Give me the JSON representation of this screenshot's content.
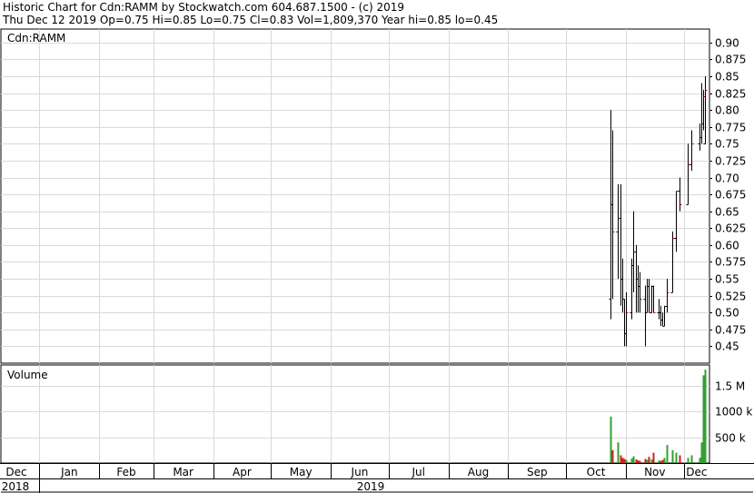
{
  "header": {
    "line1": "Historic Chart for Cdn:RAMM by Stockwatch.com 604.687.1500 - (c) 2019",
    "line2": "Thu Dec 12 2019  Op=0.75  Hi=0.85  Lo=0.75  Cl=0.83  Vol=1,809,370  Year hi=0.85  lo=0.45"
  },
  "chart_data": {
    "type": "ohlc",
    "symbol_label": "Cdn:RAMM",
    "volume_label": "Volume",
    "price_axis": {
      "min": 0.425,
      "max": 0.92,
      "ticks": [
        0.45,
        0.475,
        0.5,
        0.525,
        0.55,
        0.575,
        0.6,
        0.625,
        0.65,
        0.675,
        0.7,
        0.725,
        0.75,
        0.775,
        0.8,
        0.825,
        0.85,
        0.875,
        0.9
      ],
      "tick_labels": [
        "0.45",
        "0.475",
        "0.50",
        "0.525",
        "0.55",
        "0.575",
        "0.60",
        "0.625",
        "0.65",
        "0.675",
        "0.70",
        "0.725",
        "0.75",
        "0.775",
        "0.80",
        "0.825",
        "0.85",
        "0.875",
        "0.90"
      ]
    },
    "volume_axis": {
      "min": 0,
      "max": 1900000,
      "ticks": [
        500000,
        1000000,
        1500000
      ],
      "tick_labels": [
        "500 k",
        "1000 k",
        "1.5 M"
      ]
    },
    "date_range": [
      "2018-12-12",
      "2019-12-12"
    ],
    "months": [
      {
        "label": "Dec",
        "date": "2018-12-01"
      },
      {
        "label": "Jan",
        "date": "2019-01-01"
      },
      {
        "label": "Feb",
        "date": "2019-02-01"
      },
      {
        "label": "Mar",
        "date": "2019-03-01"
      },
      {
        "label": "Apr",
        "date": "2019-04-01"
      },
      {
        "label": "May",
        "date": "2019-05-01"
      },
      {
        "label": "Jun",
        "date": "2019-06-01"
      },
      {
        "label": "Jul",
        "date": "2019-07-01"
      },
      {
        "label": "Aug",
        "date": "2019-08-01"
      },
      {
        "label": "Sep",
        "date": "2019-09-01"
      },
      {
        "label": "Oct",
        "date": "2019-10-01"
      },
      {
        "label": "Nov",
        "date": "2019-11-01"
      },
      {
        "label": "Dec",
        "date": "2019-12-01"
      }
    ],
    "years": [
      {
        "label": "2018"
      },
      {
        "label": "2019"
      }
    ],
    "colors": {
      "background": "#ffffff",
      "grid": "#d9d9d9",
      "bars": "#000000",
      "close_tick": "#cc0000",
      "volume": "#33a033",
      "volume_down": "#cc2222"
    },
    "bars": [
      {
        "date": "2019-10-24",
        "open": 0.52,
        "high": 0.8,
        "low": 0.49,
        "close": 0.66,
        "volume": 900000
      },
      {
        "date": "2019-10-25",
        "open": 0.66,
        "high": 0.77,
        "low": 0.52,
        "close": 0.62,
        "volume": 250000
      },
      {
        "date": "2019-10-28",
        "open": 0.62,
        "high": 0.69,
        "low": 0.55,
        "close": 0.64,
        "volume": 400000
      },
      {
        "date": "2019-10-29",
        "open": 0.64,
        "high": 0.69,
        "low": 0.51,
        "close": 0.55,
        "volume": 150000
      },
      {
        "date": "2019-10-30",
        "open": 0.55,
        "high": 0.58,
        "low": 0.5,
        "close": 0.52,
        "volume": 100000
      },
      {
        "date": "2019-10-31",
        "open": 0.52,
        "high": 0.52,
        "low": 0.45,
        "close": 0.47,
        "volume": 80000
      },
      {
        "date": "2019-11-01",
        "open": 0.47,
        "high": 0.53,
        "low": 0.45,
        "close": 0.5,
        "volume": 60000
      },
      {
        "date": "2019-11-04",
        "open": 0.5,
        "high": 0.58,
        "low": 0.49,
        "close": 0.57,
        "volume": 90000
      },
      {
        "date": "2019-11-05",
        "open": 0.57,
        "high": 0.65,
        "low": 0.53,
        "close": 0.59,
        "volume": 130000
      },
      {
        "date": "2019-11-06",
        "open": 0.59,
        "high": 0.6,
        "low": 0.5,
        "close": 0.55,
        "volume": 70000
      },
      {
        "date": "2019-11-07",
        "open": 0.55,
        "high": 0.57,
        "low": 0.5,
        "close": 0.54,
        "volume": 50000
      },
      {
        "date": "2019-11-08",
        "open": 0.54,
        "high": 0.56,
        "low": 0.5,
        "close": 0.52,
        "volume": 40000
      },
      {
        "date": "2019-11-11",
        "open": 0.52,
        "high": 0.54,
        "low": 0.45,
        "close": 0.5,
        "volume": 80000
      },
      {
        "date": "2019-11-12",
        "open": 0.5,
        "high": 0.55,
        "low": 0.5,
        "close": 0.54,
        "volume": 60000
      },
      {
        "date": "2019-11-13",
        "open": 0.54,
        "high": 0.55,
        "low": 0.5,
        "close": 0.5,
        "volume": 120000
      },
      {
        "date": "2019-11-14",
        "open": 0.5,
        "high": 0.54,
        "low": 0.5,
        "close": 0.54,
        "volume": 70000
      },
      {
        "date": "2019-11-15",
        "open": 0.54,
        "high": 0.54,
        "low": 0.5,
        "close": 0.5,
        "volume": 200000
      },
      {
        "date": "2019-11-18",
        "open": 0.5,
        "high": 0.52,
        "low": 0.49,
        "close": 0.5,
        "volume": 50000
      },
      {
        "date": "2019-11-19",
        "open": 0.5,
        "high": 0.51,
        "low": 0.48,
        "close": 0.49,
        "volume": 40000
      },
      {
        "date": "2019-11-20",
        "open": 0.49,
        "high": 0.5,
        "low": 0.48,
        "close": 0.48,
        "volume": 60000
      },
      {
        "date": "2019-11-21",
        "open": 0.48,
        "high": 0.51,
        "low": 0.48,
        "close": 0.51,
        "volume": 100000
      },
      {
        "date": "2019-11-22",
        "open": 0.51,
        "high": 0.55,
        "low": 0.5,
        "close": 0.53,
        "volume": 350000
      },
      {
        "date": "2019-11-25",
        "open": 0.53,
        "high": 0.62,
        "low": 0.53,
        "close": 0.61,
        "volume": 250000
      },
      {
        "date": "2019-11-27",
        "open": 0.61,
        "high": 0.68,
        "low": 0.59,
        "close": 0.68,
        "volume": 200000
      },
      {
        "date": "2019-11-29",
        "open": 0.68,
        "high": 0.7,
        "low": 0.65,
        "close": 0.66,
        "volume": 150000
      },
      {
        "date": "2019-12-03",
        "open": 0.66,
        "high": 0.75,
        "low": 0.66,
        "close": 0.72,
        "volume": 100000
      },
      {
        "date": "2019-12-05",
        "open": 0.72,
        "high": 0.77,
        "low": 0.71,
        "close": 0.75,
        "volume": 150000
      },
      {
        "date": "2019-12-09",
        "open": 0.75,
        "high": 0.78,
        "low": 0.74,
        "close": 0.76,
        "volume": 100000
      },
      {
        "date": "2019-12-10",
        "open": 0.76,
        "high": 0.84,
        "low": 0.75,
        "close": 0.78,
        "volume": 400000
      },
      {
        "date": "2019-12-11",
        "open": 0.78,
        "high": 0.83,
        "low": 0.77,
        "close": 0.82,
        "volume": 1700000
      },
      {
        "date": "2019-12-12",
        "open": 0.75,
        "high": 0.85,
        "low": 0.75,
        "close": 0.83,
        "volume": 1809370
      }
    ]
  }
}
